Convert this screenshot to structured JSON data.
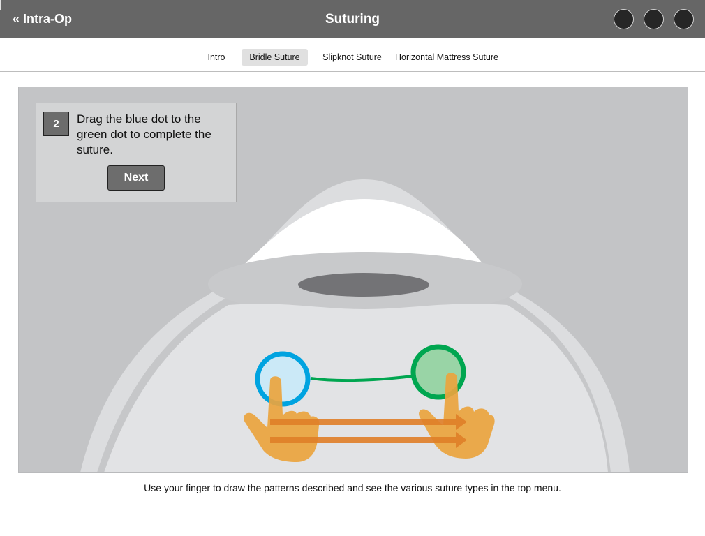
{
  "header": {
    "back_label": "« Intra-Op",
    "title": "Suturing",
    "action_buttons": [
      "circle-button-1",
      "circle-button-2",
      "circle-button-3"
    ]
  },
  "tabs": [
    {
      "label": "Intro",
      "active": false
    },
    {
      "label": "Bridle Suture",
      "active": true
    },
    {
      "label": "Slipknot Suture",
      "active": false
    },
    {
      "label": "Horizontal Mattress Suture",
      "active": false
    }
  ],
  "instruction": {
    "step_number": "2",
    "text": "Drag the blue dot to the green dot to complete the suture.",
    "next_label": "Next"
  },
  "footer": {
    "hint": "Use your finger to draw the patterns described and see the various suture types in the top menu."
  },
  "colors": {
    "header_bg": "#666666",
    "stage_bg": "#c3c4c6",
    "blue_dot": "#00a3e0",
    "green_dot": "#00a650",
    "hand": "#eaa43e",
    "arrow": "#e07f28"
  }
}
